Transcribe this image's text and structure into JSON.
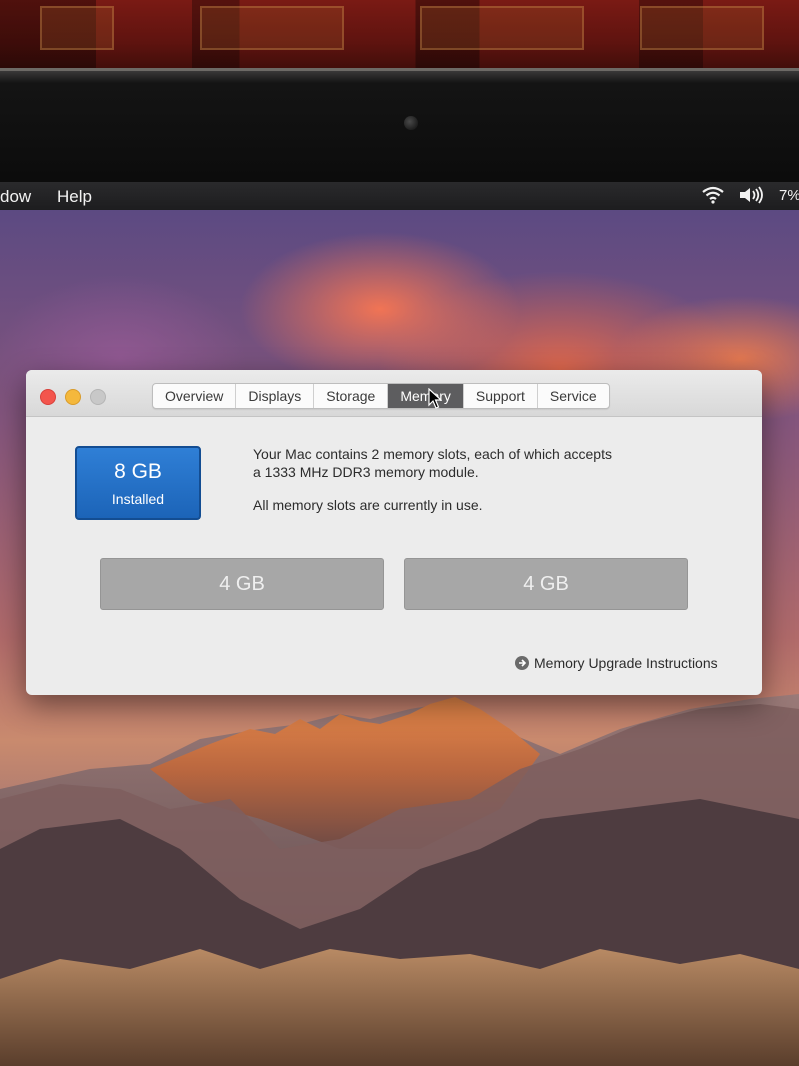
{
  "menubar": {
    "items": [
      "dow",
      "Help"
    ],
    "battery": "7%"
  },
  "window": {
    "tabs": [
      {
        "label": "Overview",
        "active": false
      },
      {
        "label": "Displays",
        "active": false
      },
      {
        "label": "Storage",
        "active": false
      },
      {
        "label": "Memory",
        "active": true
      },
      {
        "label": "Support",
        "active": false
      },
      {
        "label": "Service",
        "active": false
      }
    ],
    "memory": {
      "total": "8 GB",
      "total_caption": "Installed",
      "description_line1": "Your Mac contains 2 memory slots, each of which accepts",
      "description_line2": "a 1333 MHz DDR3 memory module.",
      "status": "All memory slots are currently in use.",
      "slots": [
        "4 GB",
        "4 GB"
      ],
      "upgrade_link": "Memory Upgrade Instructions"
    }
  },
  "colors": {
    "active_tab": "#5d5d5f",
    "badge": "#1c64b8",
    "slot": "#a7a7a7",
    "close": "#f3554d",
    "minimize": "#f4b83c"
  }
}
